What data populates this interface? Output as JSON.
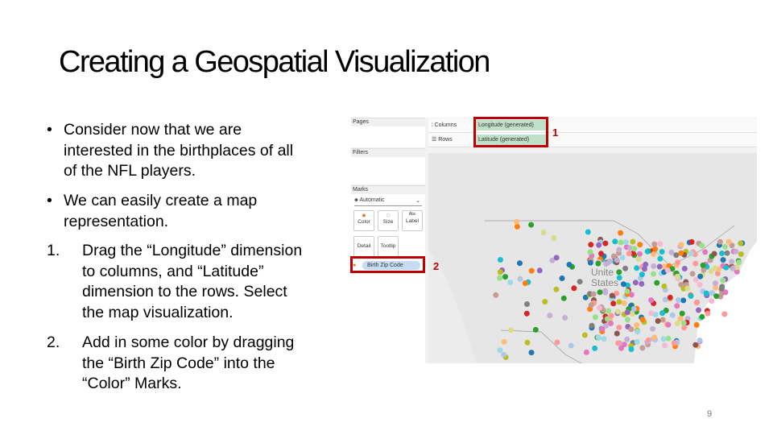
{
  "title": "Creating a Geospatial Visualization",
  "bullets": [
    {
      "marker": "•",
      "lines": [
        "Consider now that we are",
        "interested in the birthplaces of all",
        "of the NFL players."
      ]
    },
    {
      "marker": "•",
      "lines": [
        "We can easily create a map",
        "representation."
      ]
    },
    {
      "marker": "1.",
      "lines": [
        "Drag the “Longitude” dimension",
        "to columns, and “Latitude”",
        "dimension to the rows. Select",
        "the map visualization."
      ]
    },
    {
      "marker": "2.",
      "lines": [
        "Add in some color by dragging",
        "the “Birth Zip Code” into the",
        "“Color” Marks."
      ]
    }
  ],
  "screenshot": {
    "pages_label": "Pages",
    "filters_label": "Filters",
    "marks_label": "Marks",
    "mark_type": "Automatic",
    "mark_buttons": [
      "Color",
      "Size",
      "Label",
      "Detail",
      "Tooltip"
    ],
    "color_pill": "Birth Zip Code",
    "columns_label": "Columns",
    "rows_label": "Rows",
    "columns_pill": "Longitude (generated)",
    "rows_pill": "Latitude (generated)",
    "map_label": [
      "Unite",
      "States"
    ],
    "callout_1": "1",
    "callout_2": "2",
    "dot_colors": [
      "#1f77b4",
      "#ff7f0e",
      "#2ca02c",
      "#d62728",
      "#9467bd",
      "#8c564b",
      "#e377c2",
      "#7f7f7f",
      "#bcbd22",
      "#17becf",
      "#aec7e8",
      "#ffbb78",
      "#98df8a",
      "#ff9896",
      "#c5b0d5",
      "#c49c94",
      "#f7b6d2",
      "#dbdb8d",
      "#9edae5"
    ]
  },
  "page_number": "9"
}
